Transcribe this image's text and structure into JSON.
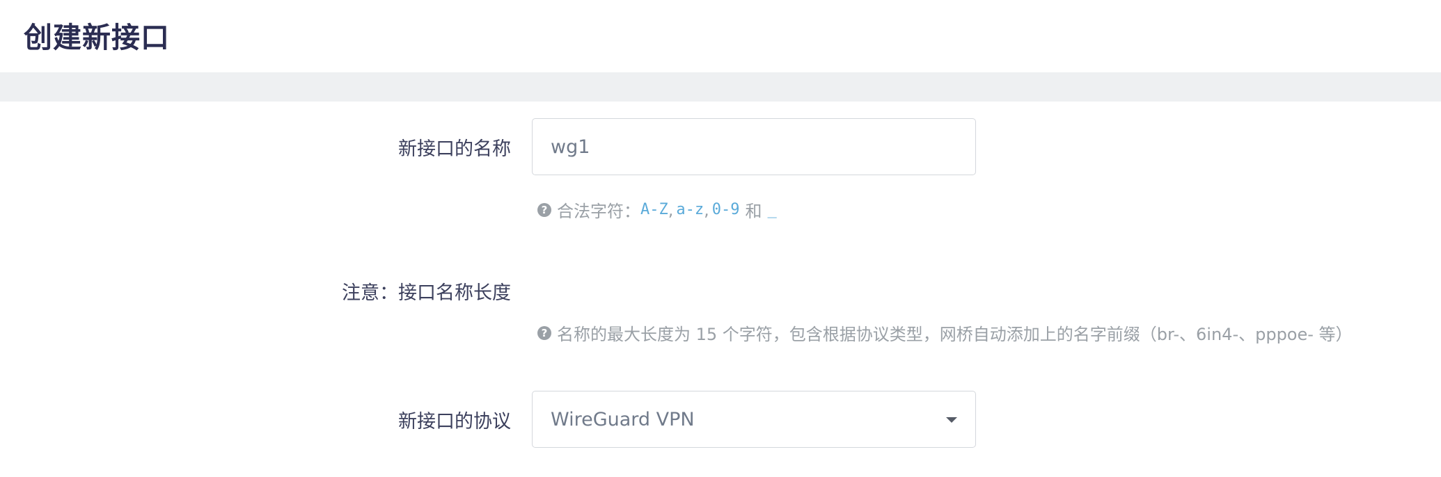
{
  "header": {
    "title": "创建新接口"
  },
  "form": {
    "name_row": {
      "label": "新接口的名称",
      "value": "wg1",
      "help": {
        "prefix": "合法字符：",
        "chars": [
          "A-Z",
          "a-z",
          "0-9"
        ],
        "separator": ",",
        "and": "和",
        "underscore": "_"
      }
    },
    "note_row": {
      "label": "注意：接口名称长度",
      "help": "名称的最大长度为 15 个字符，包含根据协议类型，网桥自动添加上的名字前缀（br-、6in4-、pppoe- 等）"
    },
    "protocol_row": {
      "label": "新接口的协议",
      "selected": "WireGuard VPN"
    }
  },
  "colors": {
    "title": "#2b2d52",
    "label": "#3b3f5c",
    "help_text": "#9aa0a6",
    "code": "#5aaad9",
    "divider": "#eef0f2",
    "border": "#d4d7dc"
  },
  "icons": {
    "help": "question-circle-icon",
    "dropdown": "chevron-down-icon"
  }
}
